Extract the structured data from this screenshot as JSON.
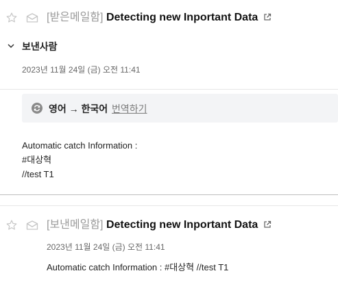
{
  "mail1": {
    "folder": "[받은메일함]",
    "subject": "Detecting new Inportant Data",
    "sender_label": "보낸사람",
    "date": "2023년 11월 24일 (금) 오전 11:41",
    "translate": {
      "lang_pair": "영어 → 한국어",
      "action": "번역하기"
    },
    "body_lines": [
      "Automatic catch Information :",
      "#대상혁",
      "//test T1"
    ]
  },
  "mail2": {
    "folder": "[보낸메일함]",
    "subject": "Detecting new Inportant Data",
    "date": "2023년 11월 24일 (금) 오전 11:41",
    "preview": "Automatic catch Information : #대상혁 //test T1"
  },
  "icons": {
    "star": "star-outline-icon",
    "envelope": "envelope-outline-icon",
    "external": "external-link-icon",
    "chevron": "chevron-down-icon",
    "refresh": "refresh-icon"
  },
  "colors": {
    "subject": "#111111",
    "muted": "#9a9a9a",
    "link": "#7a7a7a",
    "translate_bg": "#f3f4f6",
    "refresh_icon": "#8a8a8a"
  }
}
